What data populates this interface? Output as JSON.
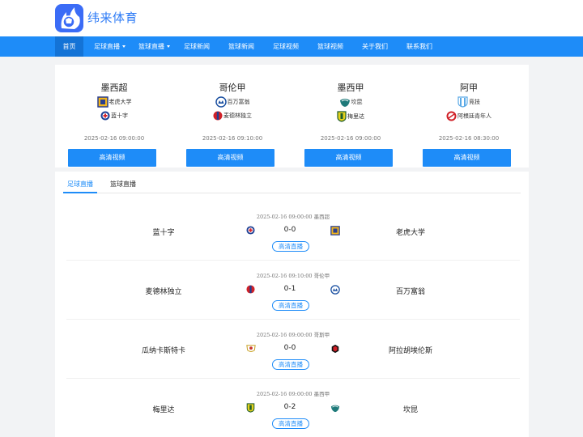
{
  "site": {
    "name": "纬来体育",
    "brand_color": "#1e8cf8"
  },
  "nav": {
    "items": [
      {
        "label": "首页",
        "active": true,
        "dropdown": false
      },
      {
        "label": "足球直播",
        "active": false,
        "dropdown": true
      },
      {
        "label": "篮球直播",
        "active": false,
        "dropdown": true
      },
      {
        "label": "足球新闻",
        "active": false,
        "dropdown": false
      },
      {
        "label": "篮球新闻",
        "active": false,
        "dropdown": false
      },
      {
        "label": "足球视频",
        "active": false,
        "dropdown": false
      },
      {
        "label": "篮球视频",
        "active": false,
        "dropdown": false
      },
      {
        "label": "关于我们",
        "active": false,
        "dropdown": false
      },
      {
        "label": "联系我们",
        "active": false,
        "dropdown": false
      }
    ]
  },
  "featured": [
    {
      "league": "墨西超",
      "team1": "老虎大学",
      "team2": "蓝十字",
      "time": "2025-02-16 09:00:00",
      "button": "高清视频"
    },
    {
      "league": "哥伦甲",
      "team1": "百万富翁",
      "team2": "麦德林独立",
      "time": "2025-02-16 09:10:00",
      "button": "高清视频"
    },
    {
      "league": "墨西甲",
      "team1": "坎昆",
      "team2": "梅里达",
      "time": "2025-02-16 09:00:00",
      "button": "高清视频"
    },
    {
      "league": "阿甲",
      "team1": "竞技",
      "team2": "阿根廷青年人",
      "time": "2025-02-16 08:30:00",
      "button": "高清视频"
    }
  ],
  "tabs": [
    {
      "label": "足球直播",
      "active": true
    },
    {
      "label": "篮球直播",
      "active": false
    }
  ],
  "matches": [
    {
      "time": "2025-02-16 09:00:00",
      "league": "墨西超",
      "home": "蓝十字",
      "away": "老虎大学",
      "score": "0-0",
      "button": "高清直播"
    },
    {
      "time": "2025-02-16 09:10:00",
      "league": "哥伦甲",
      "home": "麦德林独立",
      "away": "百万富翁",
      "score": "0-1",
      "button": "高清直播"
    },
    {
      "time": "2025-02-16 09:00:00",
      "league": "哥斯甲",
      "home": "瓜纳卡斯特卡",
      "away": "阿拉胡埃伦斯",
      "score": "0-0",
      "button": "高清直播"
    },
    {
      "time": "2025-02-16 09:00:00",
      "league": "墨西甲",
      "home": "梅里达",
      "away": "坎昆",
      "score": "0-2",
      "button": "高清直播"
    }
  ]
}
